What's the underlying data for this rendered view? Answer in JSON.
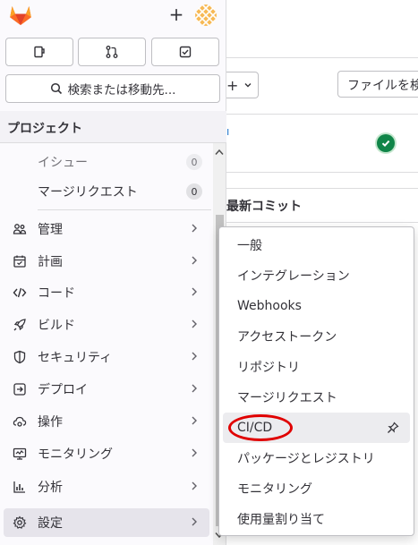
{
  "main": {
    "add_button_caret": "⌄",
    "file_button_label": "ファイルを検",
    "latest_commit_label": "最新コミット",
    "pipeline_status": "passed"
  },
  "sidebar": {
    "section_title": "プロジェクト",
    "search_label": "検索または移動先...",
    "shortcuts": [
      "issues-icon",
      "merge-requests-icon",
      "todo-icon"
    ],
    "sub_items": [
      {
        "label": "イシュー",
        "count": "0"
      },
      {
        "label": "マージリクエスト",
        "count": "0"
      }
    ],
    "items": [
      {
        "label": "管理",
        "icon": "users-icon"
      },
      {
        "label": "計画",
        "icon": "calendar-icon"
      },
      {
        "label": "コード",
        "icon": "code-icon"
      },
      {
        "label": "ビルド",
        "icon": "rocket-icon"
      },
      {
        "label": "セキュリティ",
        "icon": "shield-icon"
      },
      {
        "label": "デプロイ",
        "icon": "deploy-icon"
      },
      {
        "label": "操作",
        "icon": "cloud-gear-icon"
      },
      {
        "label": "モニタリング",
        "icon": "monitor-icon"
      },
      {
        "label": "分析",
        "icon": "chart-icon"
      },
      {
        "label": "設定",
        "icon": "settings-icon"
      }
    ]
  },
  "flyout": {
    "items": [
      "一般",
      "インテグレーション",
      "Webhooks",
      "アクセストークン",
      "リポジトリ",
      "マージリクエスト",
      "CI/CD",
      "パッケージとレジストリ",
      "モニタリング",
      "使用量割り当て"
    ],
    "highlighted": "CI/CD"
  },
  "colors": {
    "brand_orange": "#e24329",
    "success_green": "#108548",
    "annotation_red": "#e00000"
  }
}
